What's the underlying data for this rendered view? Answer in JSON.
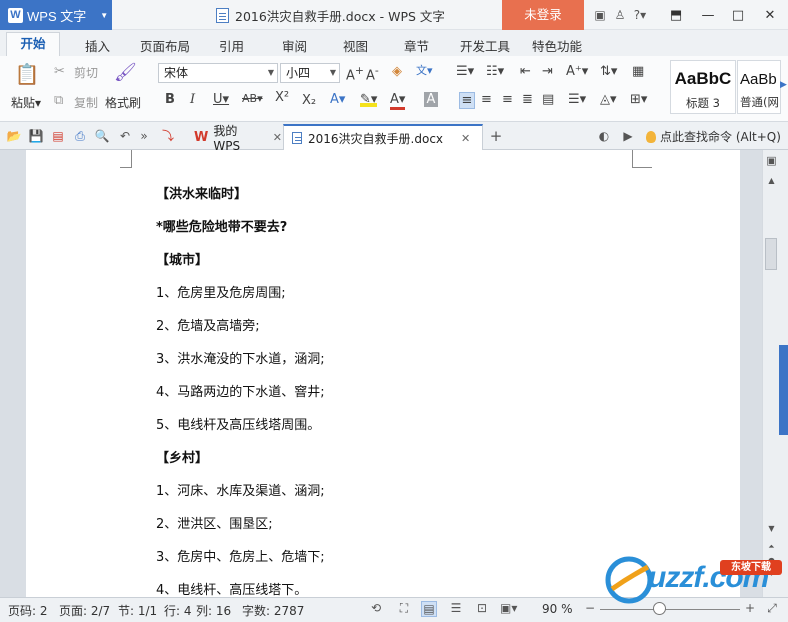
{
  "app": {
    "name": "WPS 文字",
    "window_title": "2016洪灾自救手册.docx - WPS 文字",
    "login": "未登录"
  },
  "menu": {
    "tabs": [
      "开始",
      "插入",
      "页面布局",
      "引用",
      "审阅",
      "视图",
      "章节",
      "开发工具",
      "特色功能"
    ]
  },
  "ribbon": {
    "paste": "粘贴",
    "cut": "剪切",
    "copy": "复制",
    "format_painter": "格式刷",
    "font_name": "宋体",
    "font_size": "小四",
    "styles": [
      {
        "preview": "AaBbC",
        "name": "标题 3"
      },
      {
        "preview": "AaBb",
        "name": "普通(网"
      }
    ]
  },
  "tabs": {
    "home": "我的WPS",
    "doc": "2016洪灾自救手册.docx",
    "find": "点此查找命令 (Alt+Q)"
  },
  "document": {
    "lines": [
      {
        "text": "【洪水来临时】",
        "bold": true
      },
      {
        "text": "*哪些危险地带不要去?",
        "bold": true
      },
      {
        "text": "【城市】",
        "bold": true
      },
      {
        "text": "1、危房里及危房周围;",
        "bold": false
      },
      {
        "text": "2、危墙及高墙旁;",
        "bold": false
      },
      {
        "text": "3、洪水淹没的下水道，涵洞;",
        "bold": false
      },
      {
        "text": "4、马路两边的下水道、窨井;",
        "bold": false
      },
      {
        "text": "5、电线杆及高压线塔周围。",
        "bold": false
      },
      {
        "text": "【乡村】",
        "bold": true
      },
      {
        "text": "1、河床、水库及渠道、涵洞;",
        "bold": false
      },
      {
        "text": "2、泄洪区、围垦区;",
        "bold": false
      },
      {
        "text": "3、危房中、危房上、危墙下;",
        "bold": false
      },
      {
        "text": "4、电线杆、高压线塔下。",
        "bold": false
      }
    ]
  },
  "status": {
    "page_no": "页码: 2",
    "pages": "页面: 2/7",
    "section": "节: 1/1",
    "row": "行: 4",
    "col": "列: 16",
    "words": "字数: 2787",
    "zoom": "90 %"
  },
  "watermark": {
    "brand": "uzzf.com",
    "badge": "东坡下载"
  },
  "colors": {
    "accent": "#3c74c6",
    "login_bg": "#e8704f"
  }
}
